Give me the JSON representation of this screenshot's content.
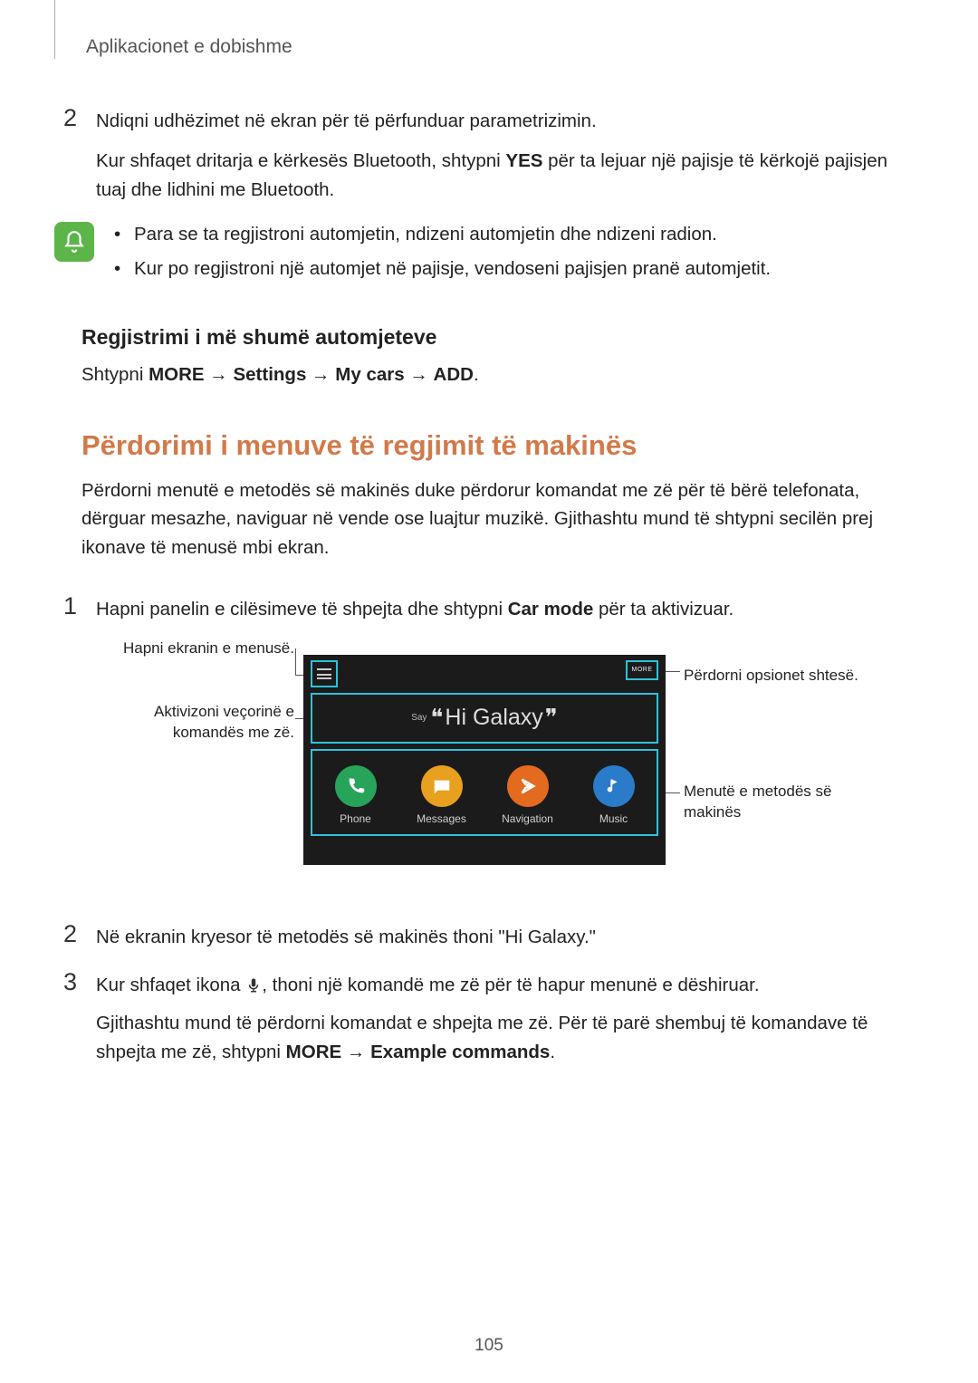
{
  "header": "Aplikacionet e dobishme",
  "step2": {
    "num": "2",
    "text": "Ndiqni udhëzimet në ekran për të përfunduar parametrizimin.",
    "para_before": "Kur shfaqet dritarja e kërkesës Bluetooth, shtypni ",
    "para_bold": "YES",
    "para_after": " për ta lejuar një pajisje të kërkojë pajisjen tuaj dhe lidhini me Bluetooth."
  },
  "notes": {
    "b1": "Para se ta regjistroni automjetin, ndizeni automjetin dhe ndizeni radion.",
    "b2": "Kur po regjistroni një automjet në pajisje, vendoseni pajisjen pranë automjetit."
  },
  "h3": "Regjistrimi i më shumë automjeteve",
  "path": {
    "pre": "Shtypni ",
    "p1": "MORE",
    "arrow": " → ",
    "p2": "Settings",
    "p3": "My cars",
    "p4": "ADD",
    "dot": "."
  },
  "h2": "Përdorimi i menuve të regjimit të makinës",
  "intro": "Përdorni menutë e metodës së makinës duke përdorur komandat me zë për të bërë telefonata, dërguar mesazhe, naviguar në vende ose luajtur muzikë. Gjithashtu mund të shtypni secilën prej ikonave të menusë mbi ekran.",
  "step_b1": {
    "num": "1",
    "before": "Hapni panelin e cilësimeve të shpejta dhe shtypni ",
    "bold": "Car mode",
    "after": " për ta aktivizuar."
  },
  "callouts": {
    "menu": "Hapni ekranin e menusë.",
    "voice": "Aktivizoni veçorinë e komandës me zë.",
    "more": "Përdorni opsionet shtesë.",
    "modes": "Menutë e metodës së makinës"
  },
  "screen": {
    "more": "MORE",
    "say": "Say",
    "higalaxy": "Hi Galaxy",
    "apps": {
      "phone": "Phone",
      "messages": "Messages",
      "navigation": "Navigation",
      "music": "Music"
    }
  },
  "step_b2": {
    "num": "2",
    "text": "Në ekranin kryesor të metodës së makinës thoni \"Hi Galaxy.\""
  },
  "step_b3": {
    "num": "3",
    "t1": "Kur shfaqet ikona ",
    "t2": ", thoni një komandë me zë për të hapur menunë e dëshiruar.",
    "p2_before": "Gjithashtu mund të përdorni komandat e shpejta me zë. Për të parë shembuj të komandave të shpejta me zë, shtypni ",
    "p2_b": "MORE",
    "p2_arrow": " → ",
    "p2_b2": "Example commands",
    "p2_dot": "."
  },
  "page_num": "105"
}
